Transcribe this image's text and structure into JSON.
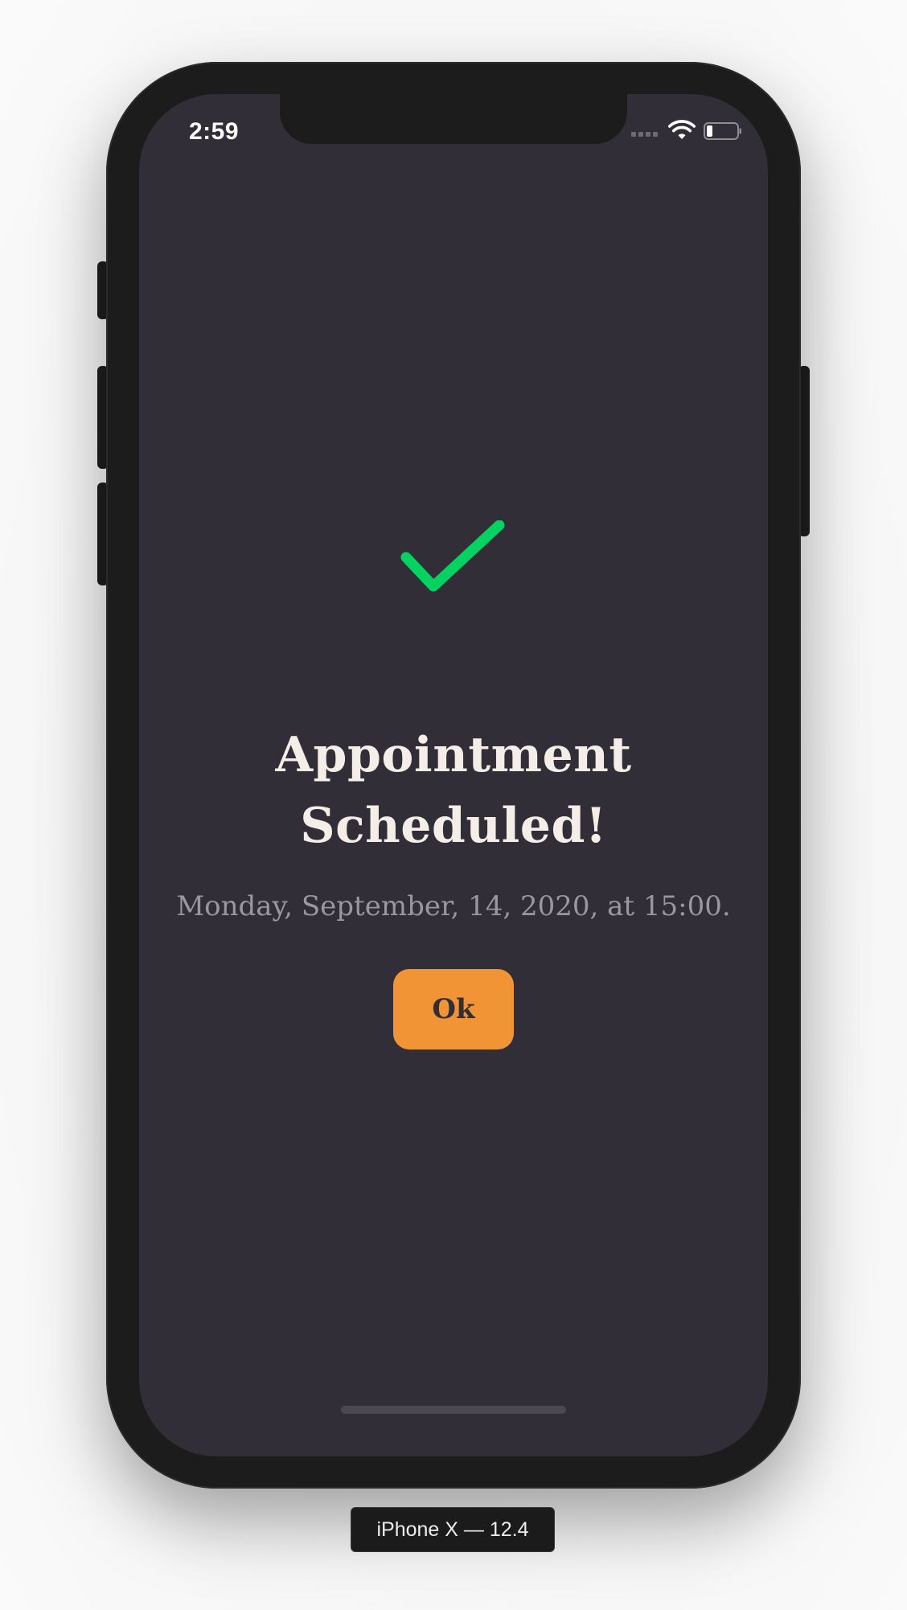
{
  "status_bar": {
    "time": "2:59"
  },
  "icons": {
    "signal": "cellular-signal-icon",
    "wifi": "wifi-icon",
    "battery": "battery-icon",
    "success": "checkmark-icon"
  },
  "confirmation": {
    "title_line1": "Appointment",
    "title_line2": "Scheduled!",
    "subtitle": "Monday, September, 14, 2020, at 15:00.",
    "ok_label": "Ok"
  },
  "device": {
    "label": "iPhone X — 12.4"
  },
  "colors": {
    "background": "#312e38",
    "accent": "#f19436",
    "success": "#04d361",
    "title_text": "#f4ede8",
    "subtitle_text": "#9a979f"
  }
}
